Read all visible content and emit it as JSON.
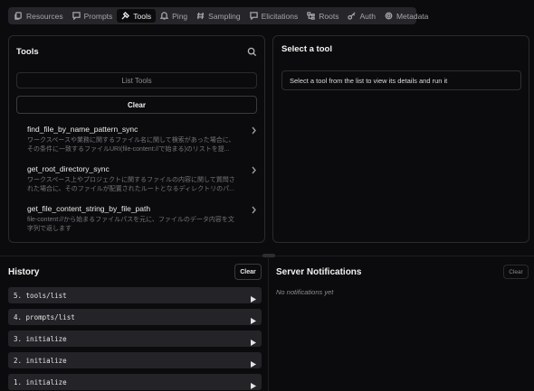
{
  "tabs": [
    {
      "label": "Resources",
      "icon": "files-icon",
      "active": false
    },
    {
      "label": "Prompts",
      "icon": "message-square-icon",
      "active": false
    },
    {
      "label": "Tools",
      "icon": "hammer-icon",
      "active": true
    },
    {
      "label": "Ping",
      "icon": "bell-icon",
      "active": false
    },
    {
      "label": "Sampling",
      "icon": "hash-icon",
      "active": false
    },
    {
      "label": "Elicitations",
      "icon": "message-square-icon",
      "active": false
    },
    {
      "label": "Roots",
      "icon": "folder-tree-icon",
      "active": false
    },
    {
      "label": "Auth",
      "icon": "key-icon",
      "active": false
    },
    {
      "label": "Metadata",
      "icon": "settings-icon",
      "active": false
    }
  ],
  "tools_panel": {
    "title": "Tools",
    "list_button": "List Tools",
    "clear_button": "Clear",
    "items": [
      {
        "name": "find_file_by_name_pattern_sync",
        "description": "ワークスペースや業務に関するファイル名に関して検索があった場合に、その条件に一致するファイルURI(file-content://で始まる)のリストを提..."
      },
      {
        "name": "get_root_directory_sync",
        "description": "ワークスペース上やプロジェクトに関するファイルの内容に関して質問された場合に、そのファイルが配置されたルートとなるディレクトリのパ..."
      },
      {
        "name": "get_file_content_string_by_file_path",
        "description": "file-content://から始まるファイルパスを元に、ファイルのデータ内容を文字列で返します"
      }
    ]
  },
  "detail_panel": {
    "title": "Select a tool",
    "message": "Select a tool from the list to view its details and run it"
  },
  "history": {
    "title": "History",
    "clear_button": "Clear",
    "items": [
      {
        "label": "5. tools/list"
      },
      {
        "label": "4. prompts/list"
      },
      {
        "label": "3. initialize"
      },
      {
        "label": "2. initialize"
      },
      {
        "label": "1. initialize"
      }
    ]
  },
  "notifications": {
    "title": "Server Notifications",
    "clear_button": "Clear",
    "empty_text": "No notifications yet"
  }
}
